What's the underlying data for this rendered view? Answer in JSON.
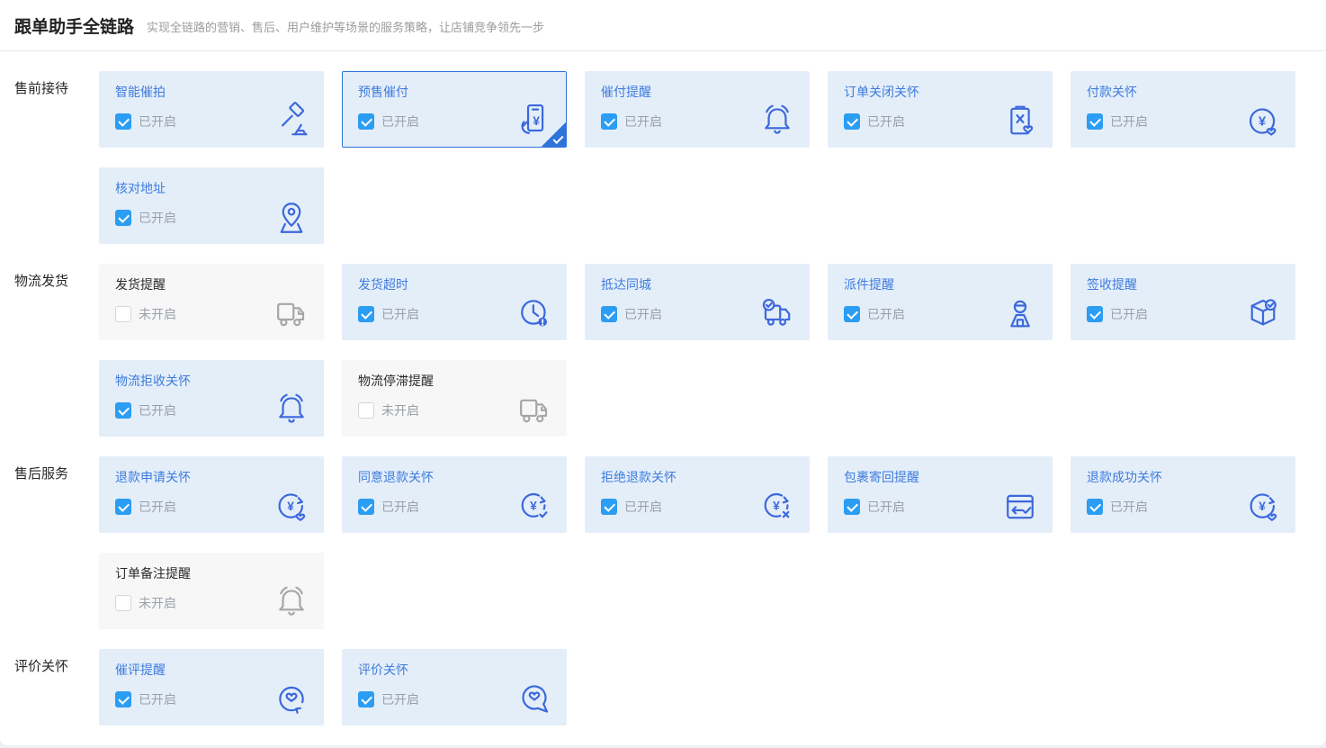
{
  "header": {
    "title": "跟单助手全链路",
    "subtitle": "实现全链路的营销、售后、用户维护等场景的服务策略，让店铺竞争领先一步"
  },
  "colors": {
    "accent_border": "#2e74d9",
    "checkbox_blue": "#2b9df3",
    "card_bg_enabled": "#e4eef9",
    "card_bg_disabled": "#f7f7f8",
    "title_blue": "#3e7cdd",
    "icon_blue": "#3c68dc",
    "icon_gray": "#a6a6a6",
    "status_gray": "#9aa0a8"
  },
  "sections": [
    {
      "label": "售前接待",
      "cards": [
        {
          "title": "智能催拍",
          "enabled": true,
          "selected": false,
          "status": "已开启",
          "icon": "gavel-icon"
        },
        {
          "title": "预售催付",
          "enabled": true,
          "selected": true,
          "status": "已开启",
          "icon": "presale-pay-icon"
        },
        {
          "title": "催付提醒",
          "enabled": true,
          "selected": false,
          "status": "已开启",
          "icon": "bell-icon"
        },
        {
          "title": "订单关闭关怀",
          "enabled": true,
          "selected": false,
          "status": "已开启",
          "icon": "order-close-clipboard-icon"
        },
        {
          "title": "付款关怀",
          "enabled": true,
          "selected": false,
          "status": "已开启",
          "icon": "yuan-heart-circle-icon"
        },
        {
          "title": "核对地址",
          "enabled": true,
          "selected": false,
          "status": "已开启",
          "icon": "map-pin-icon"
        }
      ]
    },
    {
      "label": "物流发货",
      "cards": [
        {
          "title": "发货提醒",
          "enabled": false,
          "selected": false,
          "status": "未开启",
          "icon": "truck-icon"
        },
        {
          "title": "发货超时",
          "enabled": true,
          "selected": false,
          "status": "已开启",
          "icon": "clock-alert-icon"
        },
        {
          "title": "抵达同城",
          "enabled": true,
          "selected": false,
          "status": "已开启",
          "icon": "truck-check-icon"
        },
        {
          "title": "派件提醒",
          "enabled": true,
          "selected": false,
          "status": "已开启",
          "icon": "courier-icon"
        },
        {
          "title": "签收提醒",
          "enabled": true,
          "selected": false,
          "status": "已开启",
          "icon": "package-check-icon"
        },
        {
          "title": "物流拒收关怀",
          "enabled": true,
          "selected": false,
          "status": "已开启",
          "icon": "bell-icon"
        },
        {
          "title": "物流停滞提醒",
          "enabled": false,
          "selected": false,
          "status": "未开启",
          "icon": "truck-icon"
        }
      ]
    },
    {
      "label": "售后服务",
      "cards": [
        {
          "title": "退款申请关怀",
          "enabled": true,
          "selected": false,
          "status": "已开启",
          "icon": "refund-heart-icon"
        },
        {
          "title": "同意退款关怀",
          "enabled": true,
          "selected": false,
          "status": "已开启",
          "icon": "refund-check-icon"
        },
        {
          "title": "拒绝退款关怀",
          "enabled": true,
          "selected": false,
          "status": "已开启",
          "icon": "refund-x-icon"
        },
        {
          "title": "包裹寄回提醒",
          "enabled": true,
          "selected": false,
          "status": "已开启",
          "icon": "return-card-icon"
        },
        {
          "title": "退款成功关怀",
          "enabled": true,
          "selected": false,
          "status": "已开启",
          "icon": "refund-heart-icon"
        },
        {
          "title": "订单备注提醒",
          "enabled": false,
          "selected": false,
          "status": "未开启",
          "icon": "bell-icon"
        }
      ]
    },
    {
      "label": "评价关怀",
      "cards": [
        {
          "title": "催评提醒",
          "enabled": true,
          "selected": false,
          "status": "已开启",
          "icon": "heart-cycle-icon"
        },
        {
          "title": "评价关怀",
          "enabled": true,
          "selected": false,
          "status": "已开启",
          "icon": "heart-bubble-icon"
        }
      ]
    }
  ]
}
